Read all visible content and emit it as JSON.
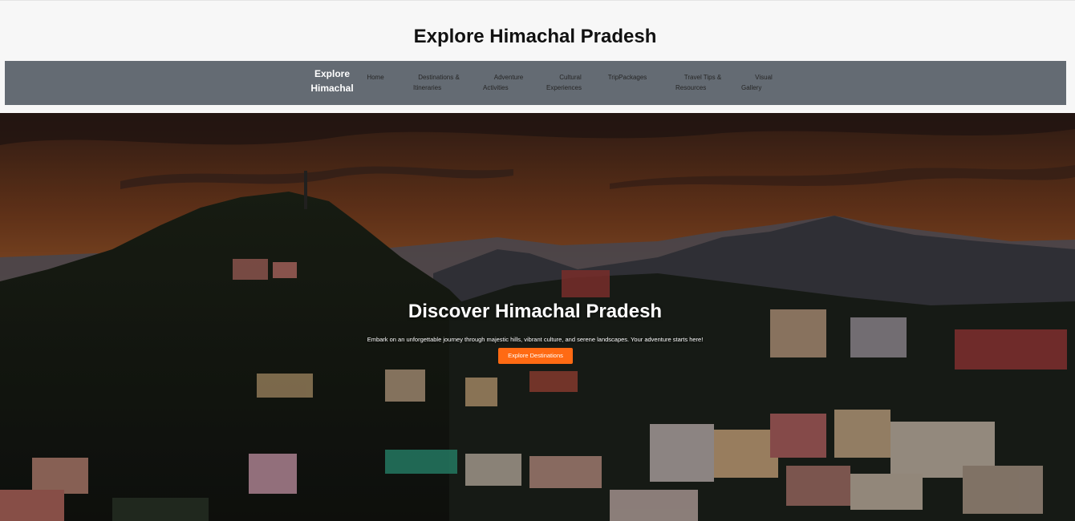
{
  "header": {
    "title": "Explore Himachal Pradesh"
  },
  "nav": {
    "brand_line1": "Explore",
    "brand_line2": "Himachal",
    "links": [
      {
        "line1": "Home",
        "line2": ""
      },
      {
        "line1": "Destinations &",
        "line2": "Itineraries"
      },
      {
        "line1": "Adventure",
        "line2": "Activities"
      },
      {
        "line1": "Cultural",
        "line2": "Experiences"
      },
      {
        "line1": "TripPackages",
        "line2": ""
      },
      {
        "line1": "Travel Tips &",
        "line2": "Resources"
      },
      {
        "line1": "Visual",
        "line2": "Gallery"
      }
    ]
  },
  "hero": {
    "title": "Discover Himachal Pradesh",
    "subtitle": "Embark on an unforgettable journey through majestic hills, vibrant culture, and serene landscapes. Your adventure starts here!",
    "button_label": "Explore Destinations"
  },
  "colors": {
    "navbar": "#646b73",
    "accent_button": "#ff6a13",
    "page_bg": "#f7f7f7"
  }
}
